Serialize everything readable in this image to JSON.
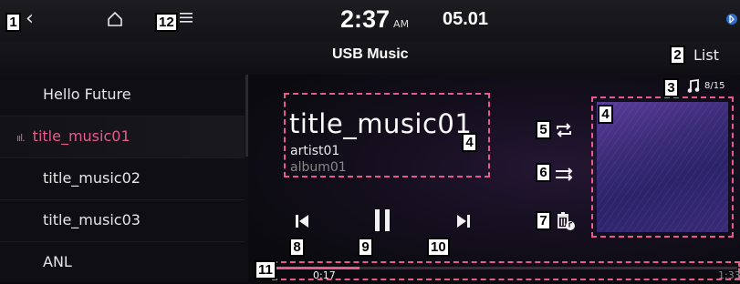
{
  "status_bar": {
    "back_icon": "chevron-left-icon",
    "home_icon": "home-icon",
    "menu_icon": "menu-icon",
    "clock": "2:37",
    "ampm": "AM",
    "date": "05.01",
    "bluetooth_icon": "bluetooth-icon"
  },
  "header": {
    "title": "USB Music",
    "list_label": "List"
  },
  "playlist": {
    "items": [
      {
        "label": "Hello Future",
        "playing": false
      },
      {
        "label": "title_music01",
        "playing": true
      },
      {
        "label": "title_music02",
        "playing": false
      },
      {
        "label": "title_music03",
        "playing": false
      },
      {
        "label": "ANL",
        "playing": false
      }
    ],
    "playing_indicator": "ııl."
  },
  "now_playing": {
    "title": "title_music01",
    "artist": "artist01",
    "album": "album01",
    "track_counter": "8/15",
    "note_icon": "music-note-icon"
  },
  "controls": {
    "repeat_icon": "repeat-icon",
    "shuffle_icon": "shuffle-icon",
    "delete_icon": "delete-music-icon",
    "prev_icon": "skip-previous-icon",
    "pause_icon": "pause-icon",
    "next_icon": "skip-next-icon"
  },
  "progress": {
    "current": "0:17",
    "total": "1:33",
    "fraction": 0.18
  },
  "callouts": {
    "c1": "1",
    "c2": "2",
    "c3": "3",
    "c4a": "4",
    "c4b": "4",
    "c5": "5",
    "c6": "6",
    "c7": "7",
    "c8": "8",
    "c9": "9",
    "c10": "10",
    "c11": "11",
    "c12": "12"
  },
  "colors": {
    "accent": "#e25d8d",
    "background": "#0b0b0f",
    "album_art": "#3a2b77"
  }
}
